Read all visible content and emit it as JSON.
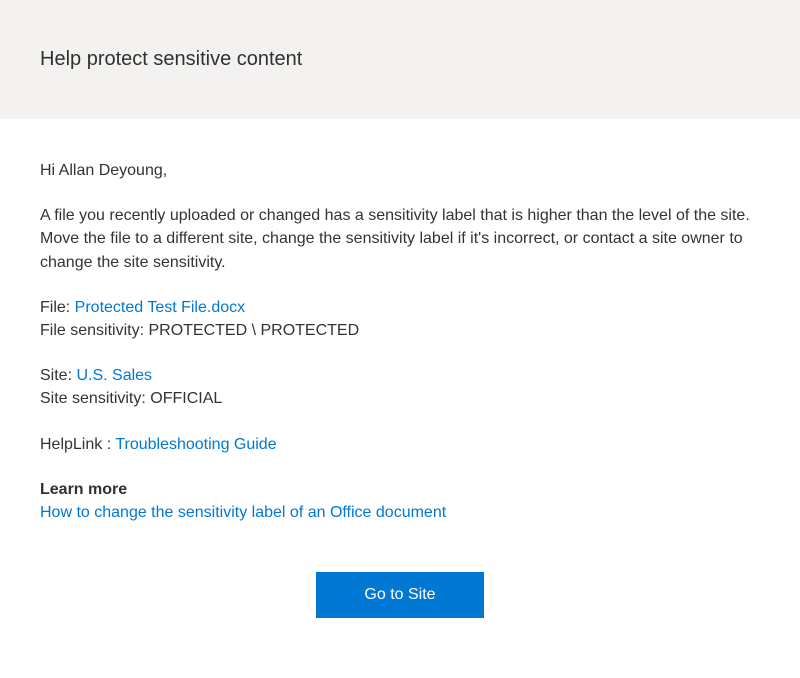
{
  "header": {
    "title": "Help protect sensitive content"
  },
  "greeting": "Hi Allan Deyoung,",
  "description": "A file you recently uploaded or changed has a sensitivity label that is higher than the level of the site. Move the file to a different site, change the sensitivity label if it's incorrect, or contact a site owner to change the site sensitivity.",
  "file": {
    "label": "File: ",
    "link_text": "Protected Test File.docx",
    "sensitivity_label": "File sensitivity: ",
    "sensitivity_value": "PROTECTED \\ PROTECTED"
  },
  "site": {
    "label": "Site: ",
    "link_text": "U.S. Sales",
    "sensitivity_label": "Site sensitivity: ",
    "sensitivity_value": "OFFICIAL"
  },
  "help": {
    "label": "HelpLink : ",
    "link_text": "Troubleshooting Guide"
  },
  "learn_more": {
    "heading": "Learn more",
    "link_text": "How to change the sensitivity label of an Office document"
  },
  "button": {
    "label": "Go to Site"
  }
}
